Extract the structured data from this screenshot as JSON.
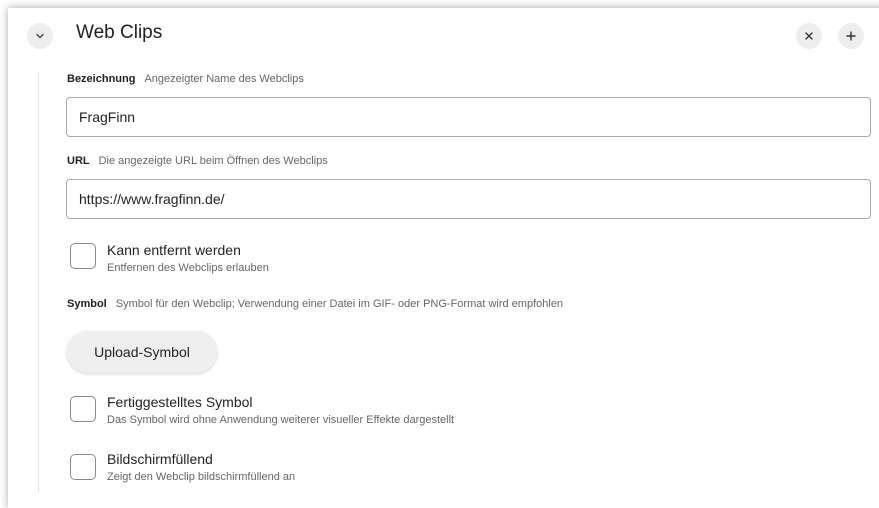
{
  "section": {
    "title": "Web Clips",
    "collapse_icon": "chevron-down-icon",
    "close_label": "×",
    "add_label": "+"
  },
  "fields": {
    "name": {
      "label": "Bezeichnung",
      "hint": "Angezeigter Name des Webclips",
      "value": "FragFinn"
    },
    "url": {
      "label": "URL",
      "hint": "Die angezeigte URL beim Öffnen des Webclips",
      "value": "https://www.fragfinn.de/"
    },
    "removable": {
      "title": "Kann entfernt werden",
      "description": "Entfernen des Webclips erlauben",
      "checked": false
    },
    "symbol": {
      "label": "Symbol",
      "hint": "Symbol für den Webclip; Verwendung einer Datei im GIF- oder PNG-Format wird empfohlen",
      "upload_label": "Upload-Symbol"
    },
    "precomposed": {
      "title": "Fertiggestelltes Symbol",
      "description": "Das Symbol wird ohne Anwendung weiterer visueller Effekte dargestellt",
      "checked": false
    },
    "fullscreen": {
      "title": "Bildschirmfüllend",
      "description": "Zeigt den Webclip bildschirmfüllend an",
      "checked": false
    }
  }
}
